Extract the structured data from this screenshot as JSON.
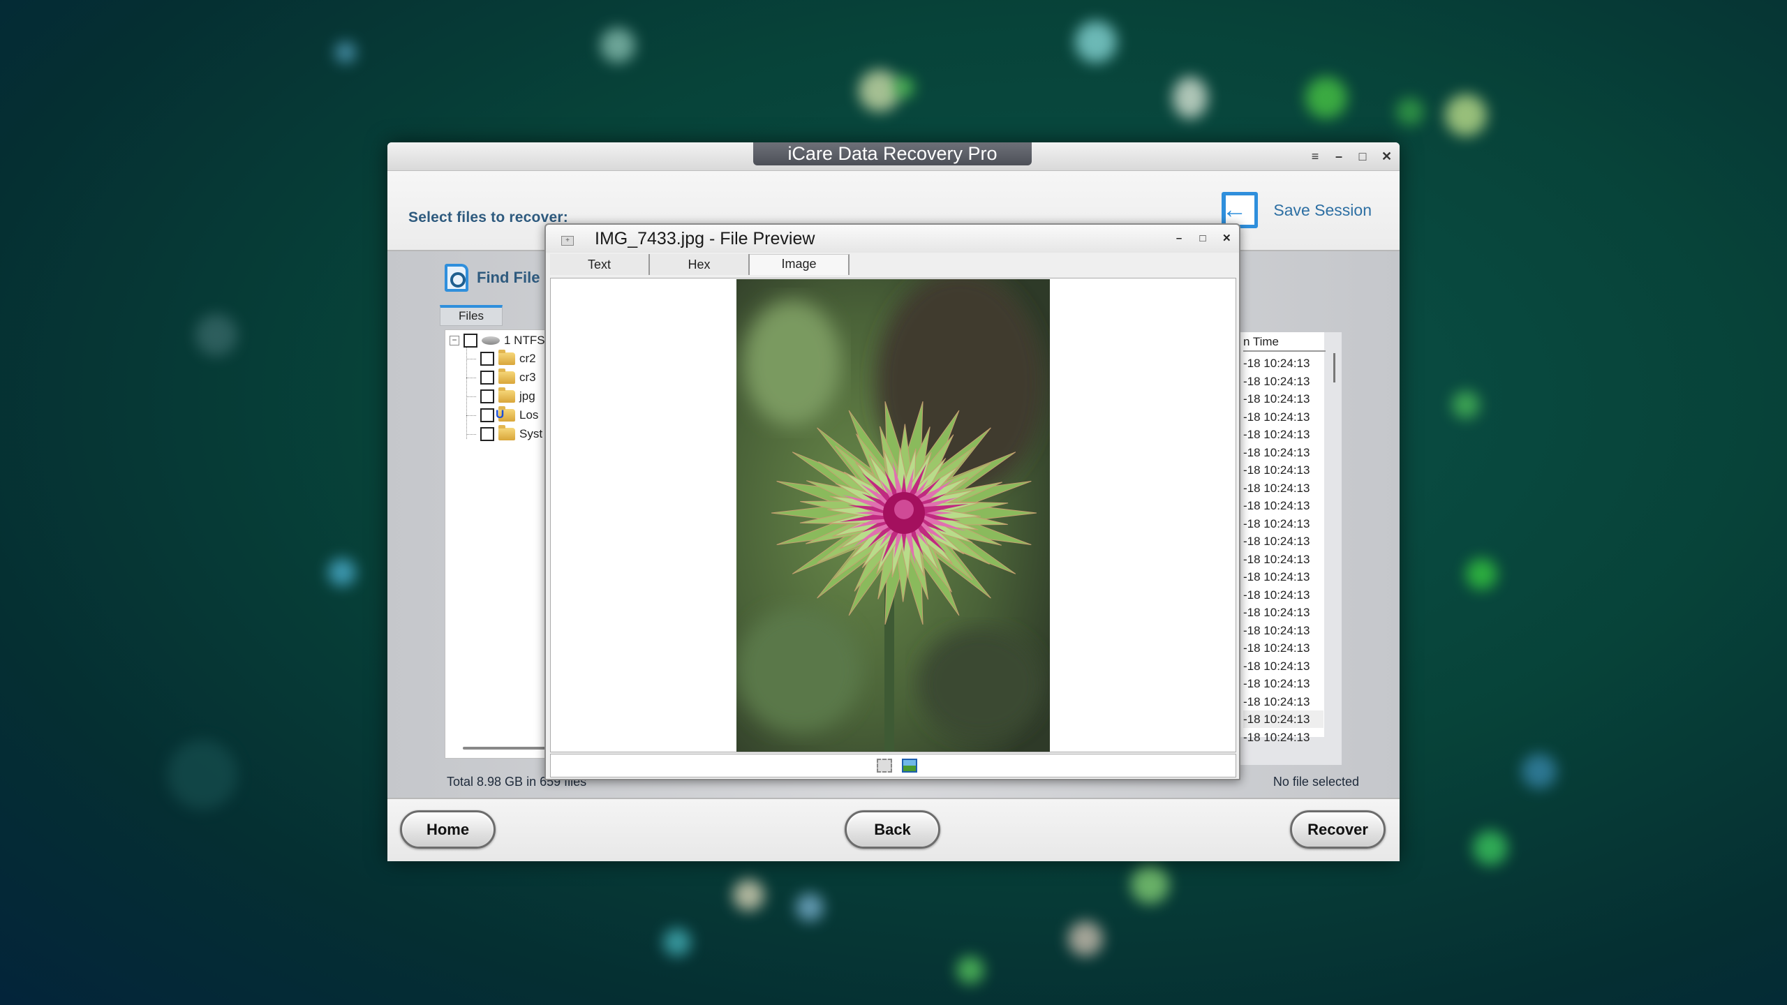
{
  "app": {
    "title": "iCare Data Recovery Pro",
    "window_controls": [
      "menu-icon",
      "minimize-icon",
      "maximize-icon",
      "close-icon"
    ],
    "window_control_glyphs": [
      "≡",
      "–",
      "□",
      "✕"
    ]
  },
  "header": {
    "prompt": "Select files to recover:",
    "save_session_label": "Save Session",
    "save_session_icon": "save-session-icon"
  },
  "sidebar": {
    "find_file_label": "Find File",
    "find_file_icon": "find-file-icon",
    "tabs": [
      {
        "label": "Files",
        "active": true
      }
    ],
    "tree": {
      "root": {
        "label": "1 NTFS",
        "icon": "drive-icon",
        "expanded": true,
        "expander": "−",
        "checked": false
      },
      "children": [
        {
          "label": "cr2",
          "icon": "folder-icon",
          "checked": false
        },
        {
          "label": "cr3",
          "icon": "folder-icon",
          "checked": false
        },
        {
          "label": "jpg",
          "icon": "folder-icon",
          "checked": false
        },
        {
          "label": "Los",
          "icon": "lost-folder-icon",
          "badge": "U",
          "checked": false
        },
        {
          "label": "Syst",
          "icon": "folder-icon",
          "checked": false
        }
      ]
    }
  },
  "file_list": {
    "column_header": "n Time",
    "rows": [
      "-18 10:24:13",
      "-18 10:24:13",
      "-18 10:24:13",
      "-18 10:24:13",
      "-18 10:24:13",
      "-18 10:24:13",
      "-18 10:24:13",
      "-18 10:24:13",
      "-18 10:24:13",
      "-18 10:24:13",
      "-18 10:24:13",
      "-18 10:24:13",
      "-18 10:24:13",
      "-18 10:24:13",
      "-18 10:24:13",
      "-18 10:24:13",
      "-18 10:24:13",
      "-18 10:24:13",
      "-18 10:24:13",
      "-18 10:24:13",
      "-18 10:24:13",
      "-18 10:24:13"
    ],
    "highlighted_row_index": 20
  },
  "status": {
    "total": "Total 8.98 GB in 659 files",
    "selection": "No file selected"
  },
  "footer": {
    "home_label": "Home",
    "back_label": "Back",
    "recover_label": "Recover"
  },
  "preview": {
    "title": "IMG_7433.jpg - File Preview",
    "system_icon_glyph": "+",
    "controls_glyphs": [
      "–",
      "□",
      "✕"
    ],
    "tabs": [
      {
        "label": "Text",
        "active": false
      },
      {
        "label": "Hex",
        "active": false
      },
      {
        "label": "Image",
        "active": true
      }
    ],
    "image_description": "thistle flower bud, magenta center with green spiky bracts",
    "toolbar": [
      "fit-to-window-icon",
      "actual-size-icon"
    ]
  },
  "colors": {
    "accent_blue": "#2f8fdc",
    "label_blue": "#2e5a7e",
    "title_tab": "#5a5d65",
    "flower_magenta": "#b0146e",
    "bract_green": "#9cc76a"
  }
}
